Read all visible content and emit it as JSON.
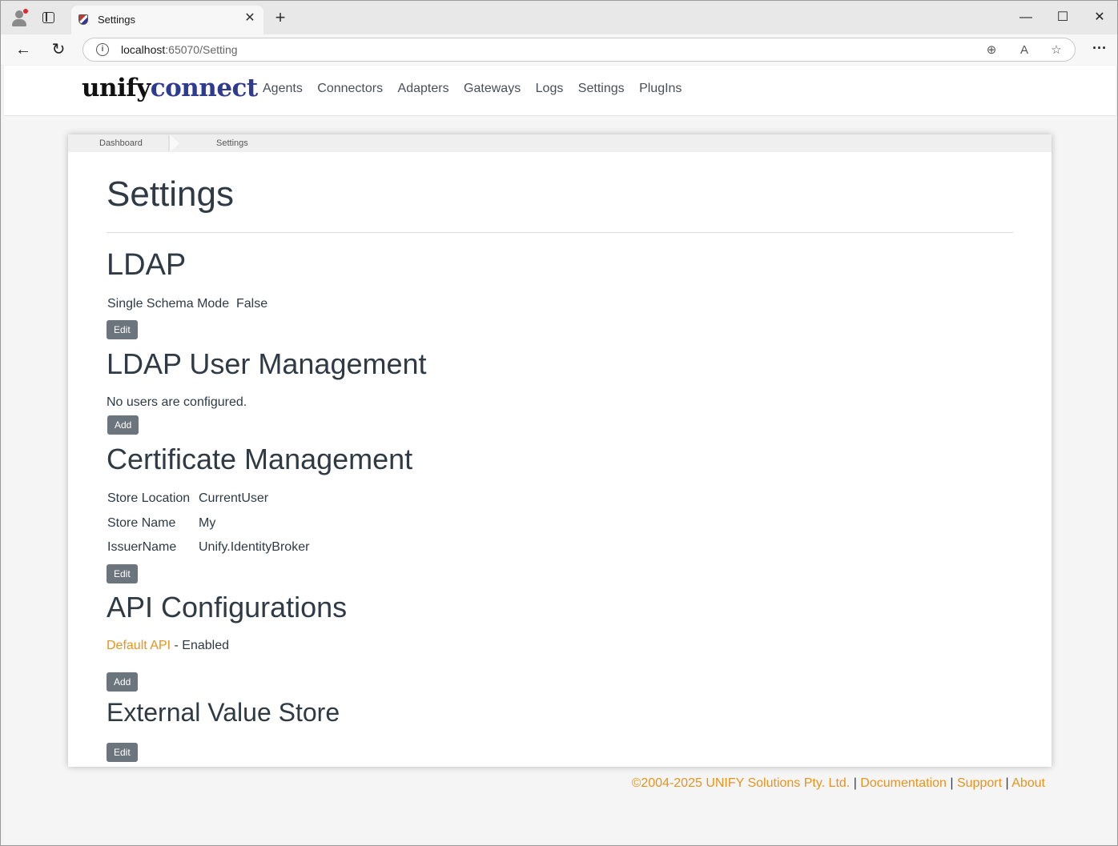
{
  "browser": {
    "tab_title": "Settings",
    "url_host": "localhost",
    "url_rest": ":65070/Setting"
  },
  "app": {
    "logo_part1": "unify",
    "logo_part2": "connect",
    "nav": [
      "Agents",
      "Connectors",
      "Adapters",
      "Gateways",
      "Logs",
      "Settings",
      "PlugIns"
    ]
  },
  "breadcrumbs": [
    "Dashboard",
    "Settings"
  ],
  "page_title": "Settings",
  "ldap": {
    "heading": "LDAP",
    "label": "Single Schema Mode",
    "value": "False",
    "button": "Edit"
  },
  "ldap_users": {
    "heading": "LDAP User Management",
    "message": "No users are configured.",
    "button": "Add"
  },
  "cert": {
    "heading": "Certificate Management",
    "rows": [
      {
        "label": "Store Location",
        "value": "CurrentUser"
      },
      {
        "label": "Store Name",
        "value": "My"
      },
      {
        "label": "IssuerName",
        "value": "Unify.IdentityBroker"
      }
    ],
    "button": "Edit"
  },
  "api": {
    "heading": "API Configurations",
    "link": "Default API",
    "status": " - Enabled",
    "button": "Add"
  },
  "evs": {
    "heading": "External Value Store",
    "button": "Edit"
  },
  "footer": {
    "copyright": "©2004-2025 UNIFY Solutions Pty. Ltd.",
    "sep": " | ",
    "links": [
      "Documentation",
      "Support",
      "About"
    ]
  },
  "colors": {
    "accent_orange": "#e8931c",
    "logo_blue": "#2f3b8f",
    "button_gray": "#6c757d"
  }
}
